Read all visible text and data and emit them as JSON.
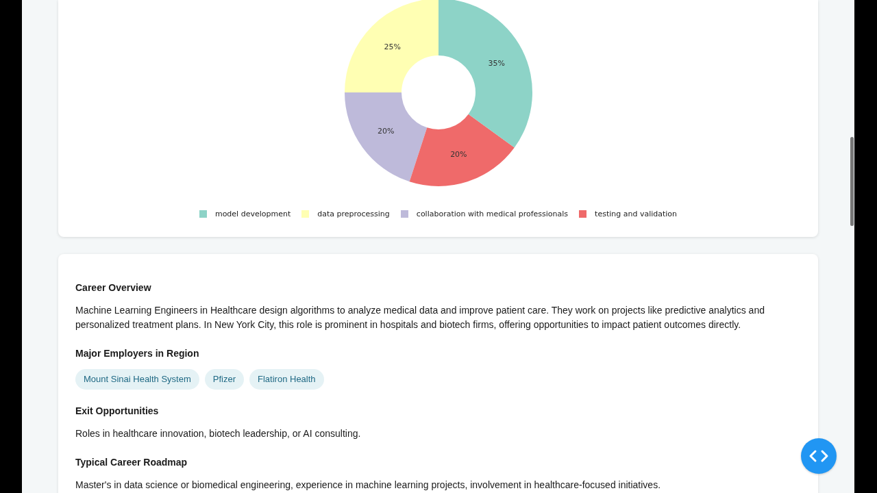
{
  "chart": {
    "chart_data": {
      "type": "donut",
      "categories": [
        "model development",
        "data preprocessing",
        "collaboration with medical professionals",
        "testing and validation"
      ],
      "values": [
        35,
        25,
        20,
        20
      ],
      "colors": [
        "#8dd3c7",
        "#ffffb3",
        "#bebada",
        "#ef6a6a"
      ],
      "value_labels": [
        "35%",
        "25%",
        "20%",
        "20%"
      ]
    }
  },
  "sections": [
    {
      "kind": "text",
      "heading": "Career Overview",
      "text": "Machine Learning Engineers in Healthcare design algorithms to analyze medical data and improve patient care. They work on projects like predictive analytics and personalized treatment plans. In New York City, this role is prominent in hospitals and biotech firms, offering opportunities to impact patient outcomes directly."
    },
    {
      "kind": "tags",
      "heading": "Major Employers in Region",
      "tags": [
        "Mount Sinai Health System",
        "Pfizer",
        "Flatiron Health"
      ]
    },
    {
      "kind": "text",
      "heading": "Exit Opportunities",
      "text": "Roles in healthcare innovation, biotech leadership, or AI consulting."
    },
    {
      "kind": "text",
      "heading": "Typical Career Roadmap",
      "text": "Master's in data science or biomedical engineering, experience in machine learning projects, involvement in healthcare-focused initiatives."
    }
  ]
}
